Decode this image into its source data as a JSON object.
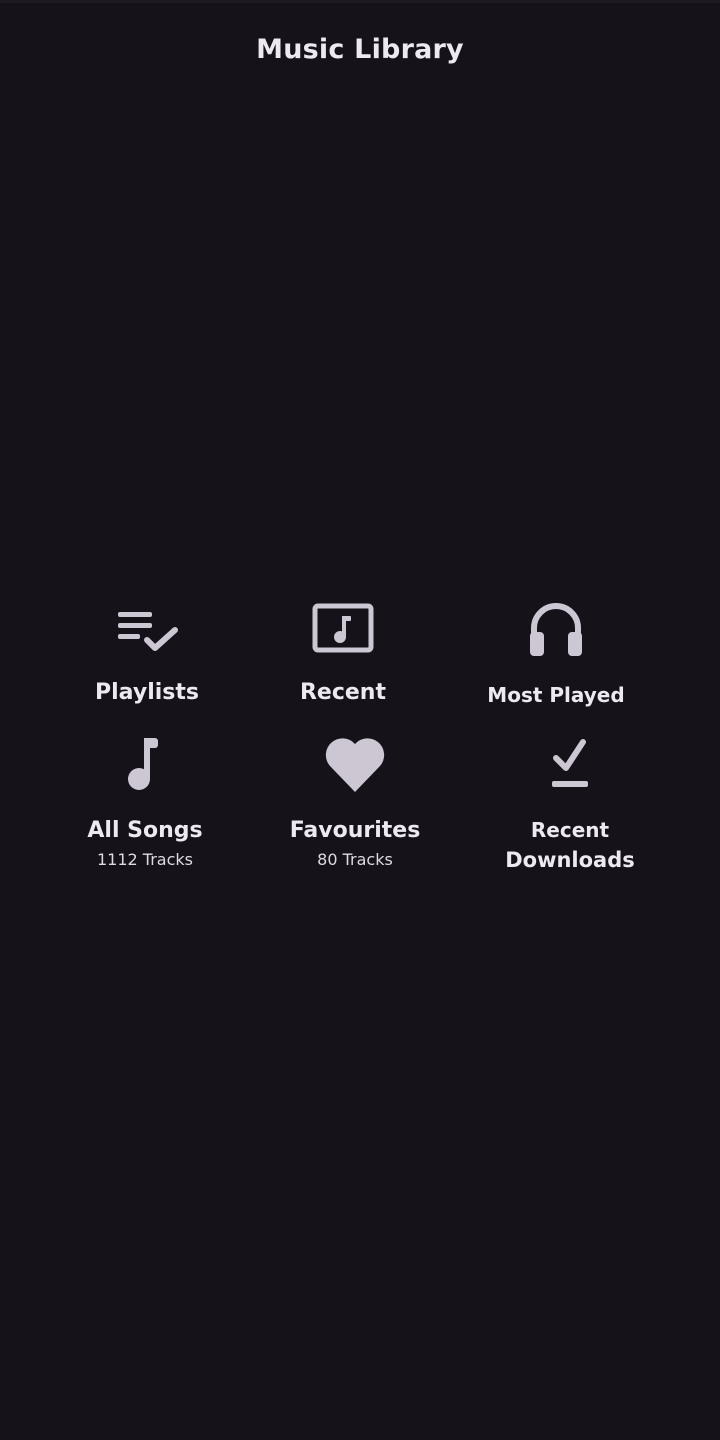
{
  "header": {
    "title": "Music Library"
  },
  "tiles": [
    {
      "label": "Playlists",
      "icon": "playlist-check-icon"
    },
    {
      "label": "Recent",
      "icon": "music-box-icon"
    },
    {
      "label": "Most Played",
      "icon": "headphones-icon"
    },
    {
      "label": "All Songs",
      "sub": "1112 Tracks",
      "icon": "music-note-icon"
    },
    {
      "label": "Favourites",
      "sub": "80 Tracks",
      "icon": "heart-icon"
    },
    {
      "label_line1": "Recent",
      "label_line2": "Downloads",
      "icon": "download-done-icon"
    }
  ],
  "colors": {
    "background": "#151219",
    "icon": "#cdc7d3",
    "text": "#ece9f0"
  }
}
